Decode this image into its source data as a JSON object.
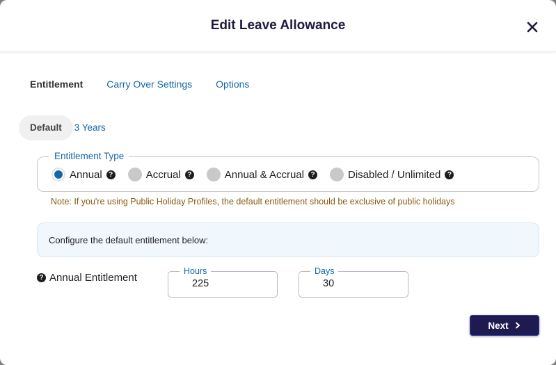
{
  "modal": {
    "title": "Edit Leave Allowance"
  },
  "tabs": [
    {
      "label": "Entitlement",
      "active": true
    },
    {
      "label": "Carry Over Settings",
      "active": false
    },
    {
      "label": "Options",
      "active": false
    }
  ],
  "subtabs": [
    {
      "label": "Default",
      "active": true
    },
    {
      "label": "3 Years",
      "active": false
    }
  ],
  "entitlement_type": {
    "legend": "Entitlement Type",
    "options": [
      {
        "label": "Annual",
        "checked": true
      },
      {
        "label": "Accrual",
        "checked": false
      },
      {
        "label": "Annual & Accrual",
        "checked": false
      },
      {
        "label": "Disabled / Unlimited",
        "checked": false
      }
    ],
    "help_icon": "question-circle-icon"
  },
  "note": "Note: If you're using Public Holiday Profiles, the default entitlement should be exclusive of public holidays",
  "info": {
    "text": "Configure the default entitlement below:"
  },
  "annual_entitlement": {
    "label": "Annual Entitlement",
    "hours": {
      "label": "Hours",
      "value": "225"
    },
    "days": {
      "label": "Days",
      "value": "30"
    }
  },
  "footer": {
    "next_label": "Next"
  },
  "colors": {
    "accent": "#1466a8",
    "primary_button": "#1f1a4f",
    "note": "#8a5a12",
    "info_bg": "#f0f7fd"
  }
}
